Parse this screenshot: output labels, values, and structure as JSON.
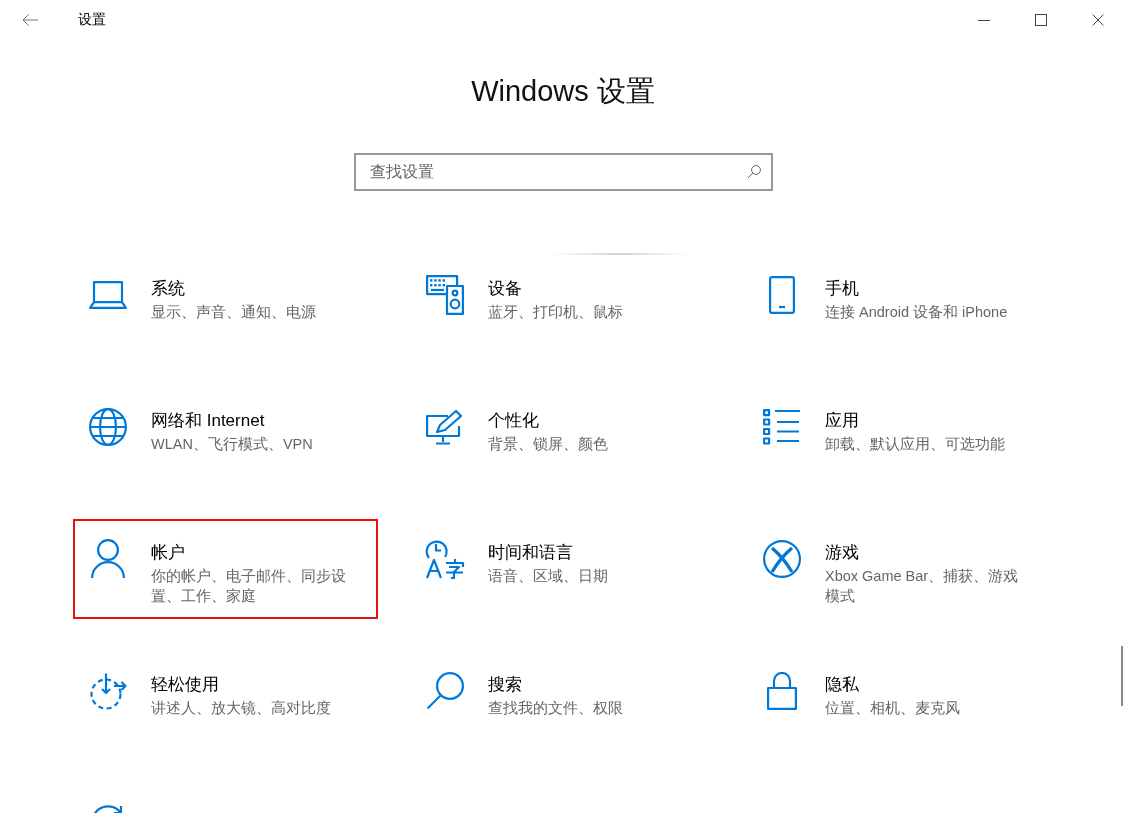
{
  "window": {
    "title": "设置"
  },
  "heading": "Windows 设置",
  "search": {
    "placeholder": "查找设置"
  },
  "items": [
    {
      "kind": "laptop",
      "title": "系统",
      "subtitle": "显示、声音、通知、电源",
      "highlighted": false
    },
    {
      "kind": "devices",
      "title": "设备",
      "subtitle": "蓝牙、打印机、鼠标",
      "highlighted": false
    },
    {
      "kind": "phone",
      "title": "手机",
      "subtitle": "连接 Android 设备和 iPhone",
      "highlighted": false
    },
    {
      "kind": "globe",
      "title": "网络和 Internet",
      "subtitle": "WLAN、飞行模式、VPN",
      "highlighted": false
    },
    {
      "kind": "personalize",
      "title": "个性化",
      "subtitle": "背景、锁屏、颜色",
      "highlighted": false
    },
    {
      "kind": "apps",
      "title": "应用",
      "subtitle": "卸载、默认应用、可选功能",
      "highlighted": false
    },
    {
      "kind": "account",
      "title": "帐户",
      "subtitle": "你的帐户、电子邮件、同步设置、工作、家庭",
      "highlighted": true
    },
    {
      "kind": "time",
      "title": "时间和语言",
      "subtitle": "语音、区域、日期",
      "highlighted": false
    },
    {
      "kind": "gaming",
      "title": "游戏",
      "subtitle": "Xbox Game Bar、捕获、游戏模式",
      "highlighted": false
    },
    {
      "kind": "ease",
      "title": "轻松使用",
      "subtitle": "讲述人、放大镜、高对比度",
      "highlighted": false
    },
    {
      "kind": "search",
      "title": "搜索",
      "subtitle": "查找我的文件、权限",
      "highlighted": false
    },
    {
      "kind": "privacy",
      "title": "隐私",
      "subtitle": "位置、相机、麦克风",
      "highlighted": false
    },
    {
      "kind": "update",
      "highlighted": false
    }
  ]
}
